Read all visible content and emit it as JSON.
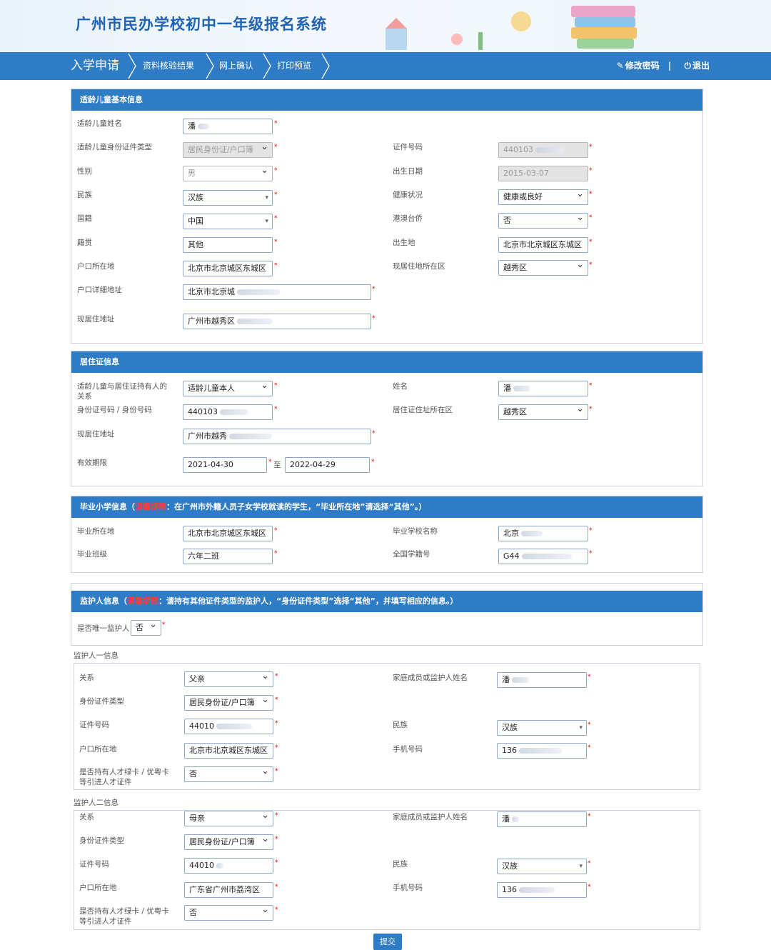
{
  "header": {
    "title": "广州市民办学校初中一年级报名系统"
  },
  "nav": {
    "steps": [
      "入学申请",
      "资料核验结果",
      "网上确认",
      "打印预览"
    ],
    "change_password": "修改密码",
    "separator": "|",
    "logout": "退出"
  },
  "child": {
    "section_title": "适龄儿童基本信息",
    "name_label": "适龄儿童姓名",
    "name_value": "潘",
    "idtype_label": "适龄儿童身份证件类型",
    "idtype_value": "居民身份证/户口簿",
    "idno_label": "证件号码",
    "idno_value": "440103",
    "gender_label": "性别",
    "gender_value": "男",
    "birth_label": "出生日期",
    "birth_value": "2015-03-07",
    "ethnic_label": "民族",
    "ethnic_value": "汉族",
    "health_label": "健康状况",
    "health_value": "健康或良好",
    "nation_label": "国籍",
    "nation_value": "中国",
    "hmt_label": "港澳台侨",
    "hmt_value": "否",
    "native_label": "籍贯",
    "native_value": "其他",
    "birthplace_label": "出生地",
    "birthplace_value": "北京市北京城区东城区",
    "hukou_label": "户口所在地",
    "hukou_value": "北京市北京城区东城区",
    "residence_district_label": "现居住地所在区",
    "residence_district_value": "越秀区",
    "hukou_addr_label": "户口详细地址",
    "hukou_addr_value": "北京市北京城",
    "residence_addr_label": "现居住地址",
    "residence_addr_value": "广州市越秀区"
  },
  "permit": {
    "section_title": "居住证信息",
    "relation_label": "适龄儿童与居住证持有人的关系",
    "relation_value": "适龄儿童本人",
    "name_label": "姓名",
    "name_value": "潘",
    "idno_label": "身份证号码 / 身份号码",
    "idno_value": "440103",
    "district_label": "居住证住址所在区",
    "district_value": "越秀区",
    "addr_label": "现居住地址",
    "addr_value": "广州市越秀",
    "valid_label": "有效期限",
    "valid_from": "2021-04-30",
    "to": "至",
    "valid_to": "2022-04-29"
  },
  "primary": {
    "section_title": "毕业小学信息（",
    "warn": "温馨提醒",
    "section_note": "：在广州市外籍人员子女学校就读的学生，“毕业所在地”请选择“其他”。）",
    "location_label": "毕业所在地",
    "location_value": "北京市北京城区东城区",
    "school_label": "毕业学校名称",
    "school_value": "北京",
    "class_label": "毕业班级",
    "class_value": "六年二班",
    "studentno_label": "全国学籍号",
    "studentno_value": "G44"
  },
  "guardian": {
    "section_title": "监护人信息（",
    "warn": "温馨提醒",
    "section_note": "：请持有其他证件类型的监护人，“身份证件类型”选择“其他”，并填写相应的信息。）",
    "only_label": "是否唯一监护人",
    "only_value": "否",
    "g1": {
      "legend": "监护人一信息",
      "relation_label": "关系",
      "relation_value": "父亲",
      "name_label": "家庭成员或监护人姓名",
      "name_value": "潘",
      "idtype_label": "身份证件类型",
      "idtype_value": "居民身份证/户口簿",
      "idno_label": "证件号码",
      "idno_value": "44010",
      "ethnic_label": "民族",
      "ethnic_value": "汉族",
      "hukou_label": "户口所在地",
      "hukou_value": "北京市北京城区东城区",
      "phone_label": "手机号码",
      "phone_value": "136",
      "talent_label": "是否持有人才绿卡 / 优粤卡等引进人才证件",
      "talent_value": "否"
    },
    "g2": {
      "legend": "监护人二信息",
      "relation_label": "关系",
      "relation_value": "母亲",
      "name_label": "家庭成员或监护人姓名",
      "name_value": "潘",
      "idtype_label": "身份证件类型",
      "idtype_value": "居民身份证/户口簿",
      "idno_label": "证件号码",
      "idno_value": "44010",
      "ethnic_label": "民族",
      "ethnic_value": "汉族",
      "hukou_label": "户口所在地",
      "hukou_value": "广东省广州市荔湾区",
      "phone_label": "手机号码",
      "phone_value": "136",
      "talent_label": "是否持有人才绿卡 / 优粤卡等引进人才证件",
      "talent_value": "否"
    }
  },
  "submit_label": "提交",
  "required_mark": "*"
}
